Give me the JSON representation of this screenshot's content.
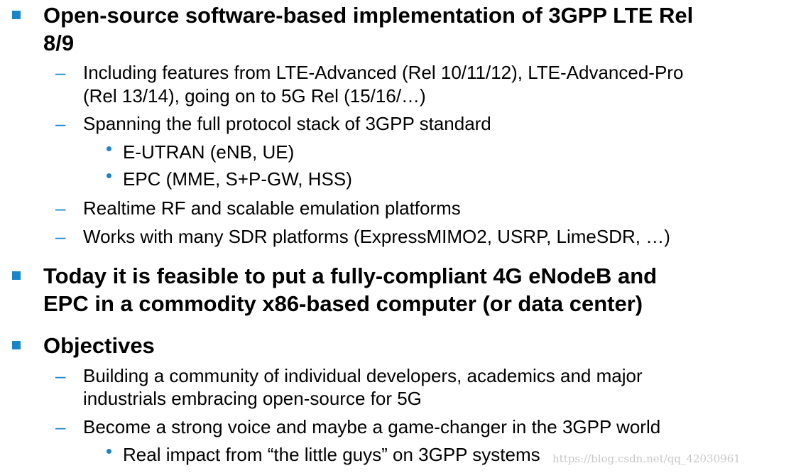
{
  "bullets": [
    {
      "lines": [
        "Open-source software-based implementation of  3GPP LTE Rel",
        "8/9"
      ],
      "subs": [
        {
          "lines": [
            "Including features from LTE-Advanced (Rel 10/11/12), LTE-Advanced-Pro",
            "(Rel 13/14), going on to 5G Rel (15/16/…)"
          ]
        },
        {
          "lines": [
            "Spanning the full protocol stack of 3GPP standard"
          ],
          "subs": [
            {
              "text": "E-UTRAN (eNB, UE)"
            },
            {
              "text": "EPC (MME, S+P-GW, HSS)"
            }
          ]
        },
        {
          "lines": [
            "Realtime RF and scalable emulation platforms"
          ]
        },
        {
          "lines": [
            "Works with many SDR platforms (ExpressMIMO2, USRP, LimeSDR, …)"
          ]
        }
      ]
    },
    {
      "lines": [
        "Today it is feasible to put a fully-compliant 4G eNodeB and",
        "EPC in a commodity x86-based computer (or data center)"
      ]
    },
    {
      "lines": [
        "Objectives"
      ],
      "subs": [
        {
          "lines": [
            "Building a community of individual developers, academics and major",
            "industrials embracing open-source for 5G"
          ]
        },
        {
          "lines": [
            "Become a strong voice and maybe a game-changer in the 3GPP world"
          ],
          "subs": [
            {
              "text": "Real impact from “the little guys” on 3GPP systems"
            }
          ]
        }
      ]
    }
  ],
  "watermark": "https://blog.csdn.net/qq_42030961",
  "colors": {
    "accent": "#1a86c8",
    "text": "#000000"
  }
}
